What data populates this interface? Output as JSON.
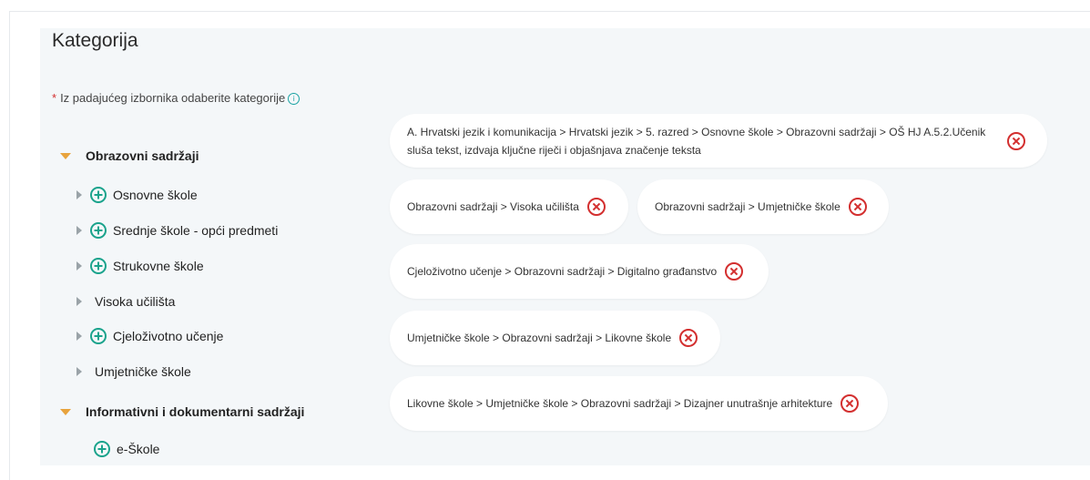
{
  "header": {
    "title": "Kategorija"
  },
  "instruction": {
    "required_mark": "*",
    "text": "Iz padajućeg izbornika odaberite kategorije",
    "info_icon": "info-icon"
  },
  "tree": {
    "group1": {
      "label": "Obrazovni sadržaji",
      "children": [
        "Osnovne škole",
        "Srednje škole - opći predmeti",
        "Strukovne škole",
        "Visoka učilišta",
        "Cjeloživotno učenje",
        "Umjetničke škole"
      ]
    },
    "group2": {
      "label": "Informativni i dokumentarni sadržaji",
      "children": [
        "e-Škole"
      ]
    }
  },
  "selected": [
    "A. Hrvatski jezik i komunikacija > Hrvatski jezik > 5. razred > Osnovne škole > Obrazovni sadržaji > OŠ HJ A.5.2.Učenik sluša tekst, izdvaja ključne riječi i objašnjava značenje teksta",
    "Obrazovni sadržaji > Visoka učilišta",
    "Obrazovni sadržaji > Umjetničke škole",
    "Cjeloživotno učenje > Obrazovni sadržaji > Digitalno građanstvo",
    "Umjetničke škole > Obrazovni sadržaji > Likovne škole",
    "Likovne škole > Umjetničke škole > Obrazovni sadržaji > Dizajner unutrašnje arhitekture"
  ],
  "colors": {
    "accent_teal": "#1aa38c",
    "remove_red": "#d32f2f",
    "caret_orange": "#e8a33d",
    "panel_bg": "#f4f7f9"
  }
}
